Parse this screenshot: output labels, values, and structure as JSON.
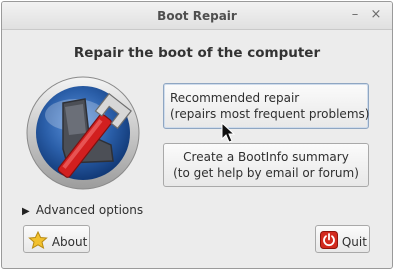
{
  "window": {
    "title": "Boot Repair",
    "minimize_label": "–",
    "close_label": "×"
  },
  "heading": "Repair the boot of the computer",
  "recommended": {
    "line1": "Recommended repair",
    "line2": "(repairs most frequent problems)"
  },
  "bootinfo": {
    "line1": "Create a BootInfo summary",
    "line2": "(to get help by email or forum)"
  },
  "advanced_label": "Advanced options",
  "about_label": "About",
  "quit_label": "Quit",
  "colors": {
    "window_bg": "#ececec",
    "focus_border": "#8fa6c2",
    "logo_blue": "#2a5ea8",
    "wrench_red": "#d21f1f",
    "quit_red": "#d22a1e",
    "about_star": "#f2c12e"
  }
}
